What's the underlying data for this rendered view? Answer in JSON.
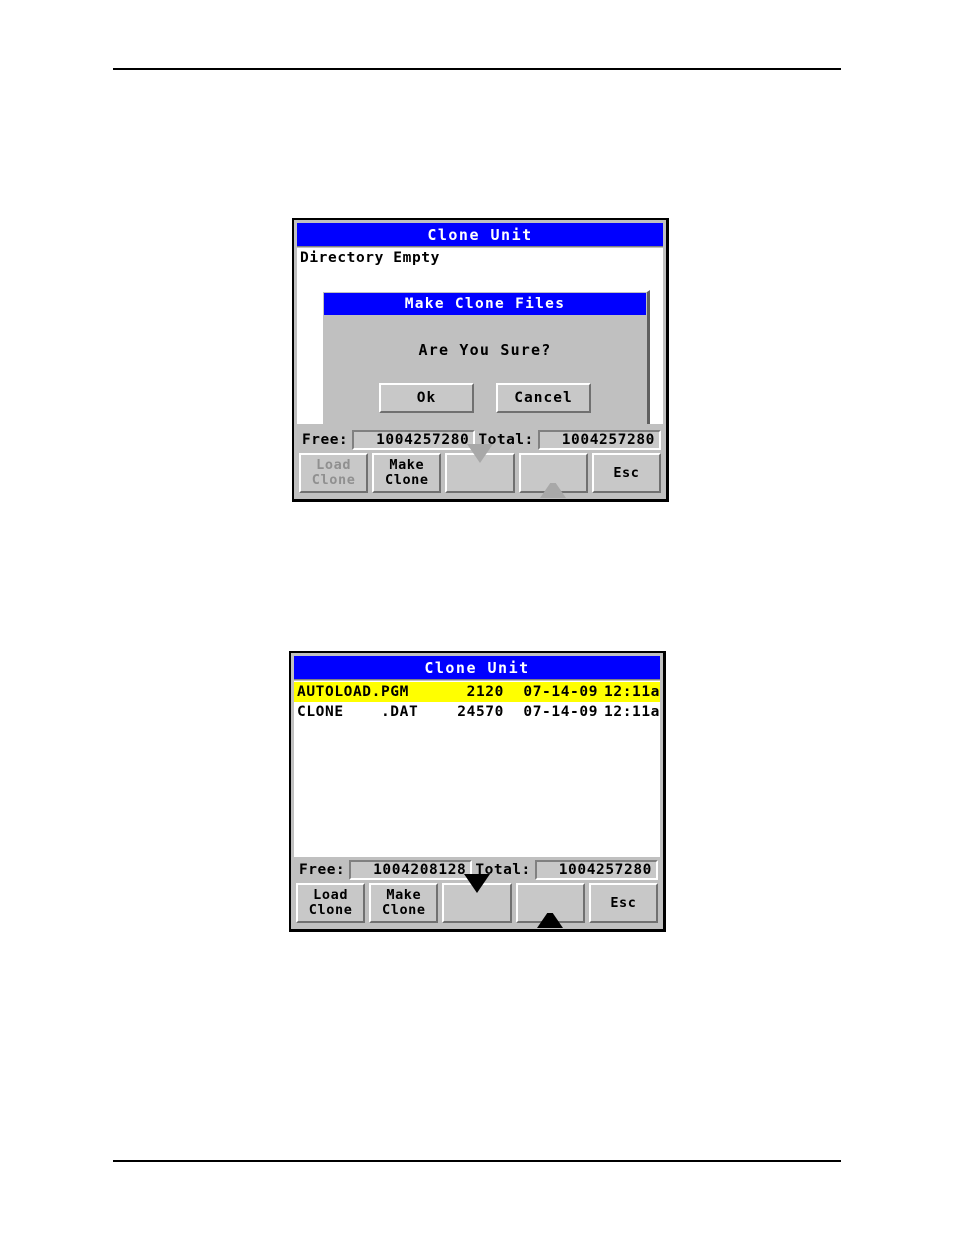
{
  "page": {
    "rule_top": true,
    "rule_bottom": true
  },
  "figure_confirm": {
    "window_title": "Clone Unit",
    "background_text": "Directory Empty",
    "dialog": {
      "title": "Make Clone Files",
      "message": "Are You Sure?",
      "ok_label": "Ok",
      "cancel_label": "Cancel"
    },
    "meters": {
      "free_label": "Free:",
      "free_value": "1004257280",
      "total_label": "Total:",
      "total_value": "1004257280"
    },
    "buttons": {
      "load_clone_line1": "Load",
      "load_clone_line2": "Clone",
      "make_clone_line1": "Make",
      "make_clone_line2": "Clone",
      "scroll_down_icon": "triangle-down-icon",
      "scroll_up_icon": "triangle-up-icon",
      "esc_label": "Esc"
    },
    "colors": {
      "titlebar": "#0000ff",
      "titlebar_text": "#ffffff",
      "panel": "#c0c0c0",
      "button_face": "#c8c8c8",
      "disabled_text": "#909090",
      "list_background": "#ffffff"
    }
  },
  "figure_list": {
    "window_title": "Clone Unit",
    "rows": [
      {
        "name": "AUTOLOAD.PGM",
        "size": "2120",
        "date": "07-14-09",
        "time": "12:11a",
        "selected": true
      },
      {
        "name": "CLONE    .DAT",
        "size": "24570",
        "date": "07-14-09",
        "time": "12:11a",
        "selected": false
      }
    ],
    "meters": {
      "free_label": "Free:",
      "free_value": "1004208128",
      "total_label": "Total:",
      "total_value": "1004257280"
    },
    "buttons": {
      "load_clone_line1": "Load",
      "load_clone_line2": "Clone",
      "make_clone_line1": "Make",
      "make_clone_line2": "Clone",
      "scroll_down_icon": "triangle-down-icon",
      "scroll_up_icon": "triangle-up-icon",
      "esc_label": "Esc"
    },
    "colors": {
      "titlebar": "#0000ff",
      "selected_row": "#ffff00",
      "list_background": "#ffffff"
    }
  }
}
